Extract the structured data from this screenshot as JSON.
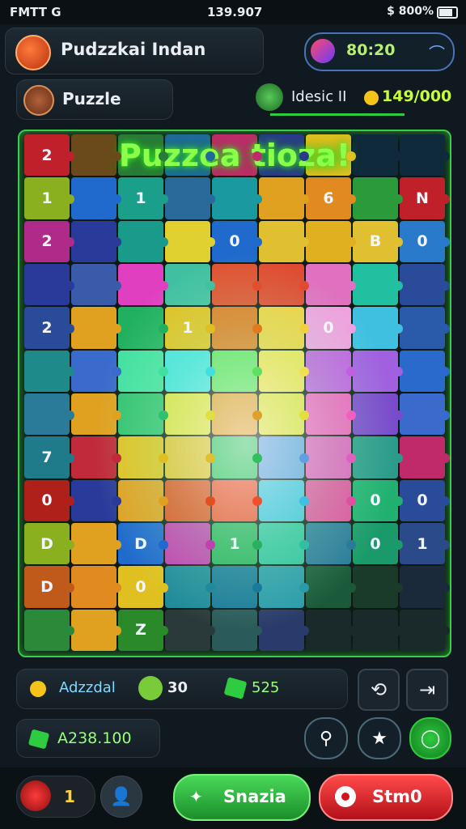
{
  "status_bar": {
    "carrier": "FMTT G",
    "time": "139.907",
    "battery": "$ 800%"
  },
  "header": {
    "app_title": "Pudzzkai Indan",
    "timer": "80:20"
  },
  "mode": {
    "label": "Puzzle"
  },
  "player": {
    "name": "Idesic II",
    "coins": "149/000"
  },
  "board": {
    "title": "Puzzea tioza!",
    "colors": {
      "accent": "#3acc4a",
      "title_glow": "#8cff4a"
    },
    "tiles": [
      [
        "2",
        "",
        "",
        "",
        "",
        "",
        "",
        "",
        ""
      ],
      [
        "1",
        "",
        "1",
        "",
        "",
        "",
        "6",
        "",
        "N"
      ],
      [
        "2",
        "",
        "",
        "",
        "0",
        "",
        "",
        "B",
        "0"
      ],
      [
        "",
        "",
        "",
        "",
        "",
        "",
        "",
        "",
        ""
      ],
      [
        "2",
        "",
        "",
        "1",
        "",
        "",
        "0",
        "",
        ""
      ],
      [
        "",
        "",
        "",
        "",
        "",
        "",
        "",
        "",
        ""
      ],
      [
        "",
        "",
        "",
        "",
        "",
        "",
        "",
        "",
        ""
      ],
      [
        "7",
        "",
        "",
        "",
        "",
        "",
        "",
        "",
        ""
      ],
      [
        "0",
        "",
        "",
        "",
        "",
        "",
        "",
        "0",
        "0"
      ],
      [
        "D",
        "",
        "D",
        "",
        "1",
        "",
        "",
        "0",
        "1"
      ],
      [
        "D",
        "",
        "0",
        "",
        "",
        "",
        "",
        "",
        ""
      ],
      [
        "",
        "",
        "Z",
        "",
        "",
        "",
        "",
        "",
        ""
      ]
    ],
    "tile_colors": [
      [
        "#c0202a",
        "#6a4a1a",
        "#2a7a3a",
        "#1f6a9a",
        "#c02a6a",
        "#2a3a8a",
        "#e0c020",
        "#0f2a3a",
        "#0f2a3a"
      ],
      [
        "#8ab020",
        "#1f6acc",
        "#1aa08a",
        "#2a6a9a",
        "#1a9aa0",
        "#e0a020",
        "#e08a20",
        "#2a9a3a",
        "#c0202a"
      ],
      [
        "#b02a8a",
        "#2a3a9a",
        "#1a9a8a",
        "#e0d030",
        "#1f6acc",
        "#e0c030",
        "#e0b020",
        "#e0c030",
        "#2a7acc"
      ],
      [
        "#2a3a9a",
        "#3a5aaa",
        "#e040c0",
        "#40c0a0",
        "#e05030",
        "#e04a30",
        "#e070c0",
        "#20c0a0",
        "#2a4a9a"
      ],
      [
        "#2a4a9a",
        "#e0a020",
        "#20b060",
        "#e0c020",
        "#e07a20",
        "#f0d040",
        "#f0a0e0",
        "#40c0e0",
        "#2a5aaa"
      ],
      [
        "#1f8a8a",
        "#3a6acc",
        "#40e0a0",
        "#40e0e0",
        "#60e060",
        "#f0e050",
        "#c060e0",
        "#a060e0",
        "#2a6acc"
      ],
      [
        "#2a7a9a",
        "#e0a020",
        "#30c070",
        "#e0e040",
        "#e0a030",
        "#e0e040",
        "#f060c0",
        "#7a4acc",
        "#3a6acc"
      ],
      [
        "#1f7a8a",
        "#c02a3a",
        "#e0c020",
        "#e0c030",
        "#30c060",
        "#60a0e0",
        "#e060c0",
        "#2a9a8a",
        "#c02a6a"
      ],
      [
        "#b0201a",
        "#2a3a9a",
        "#e0a020",
        "#e05020",
        "#f05030",
        "#40c0e0",
        "#e050a0",
        "#20b070",
        "#2a4a9a"
      ],
      [
        "#8ab020",
        "#e0a020",
        "#1f6acc",
        "#c040b0",
        "#2ab060",
        "#30c0a0",
        "#2a7a9a",
        "#1a9a6a",
        "#2a4a8a"
      ],
      [
        "#c05a1a",
        "#e08a20",
        "#e0c020",
        "#1f8a9a",
        "#1a7a9a",
        "#2a9aaa",
        "#1a5a3a",
        "#1a3a2a",
        "#1a2a3a"
      ],
      [
        "#2a8a3a",
        "#e0a020",
        "#2a8a2a",
        "#2a3a3a",
        "#2a5a5a",
        "#2a3a6a",
        "#1a2a2a",
        "#1a2a2a",
        "#1a2a2a"
      ]
    ]
  },
  "resources": {
    "name": "Adzzdal",
    "count": "30",
    "gems": "525"
  },
  "score": {
    "value": "A238.100"
  },
  "bottom": {
    "lives": "1",
    "start_label": "Snazia",
    "stop_label": "Stm0"
  }
}
